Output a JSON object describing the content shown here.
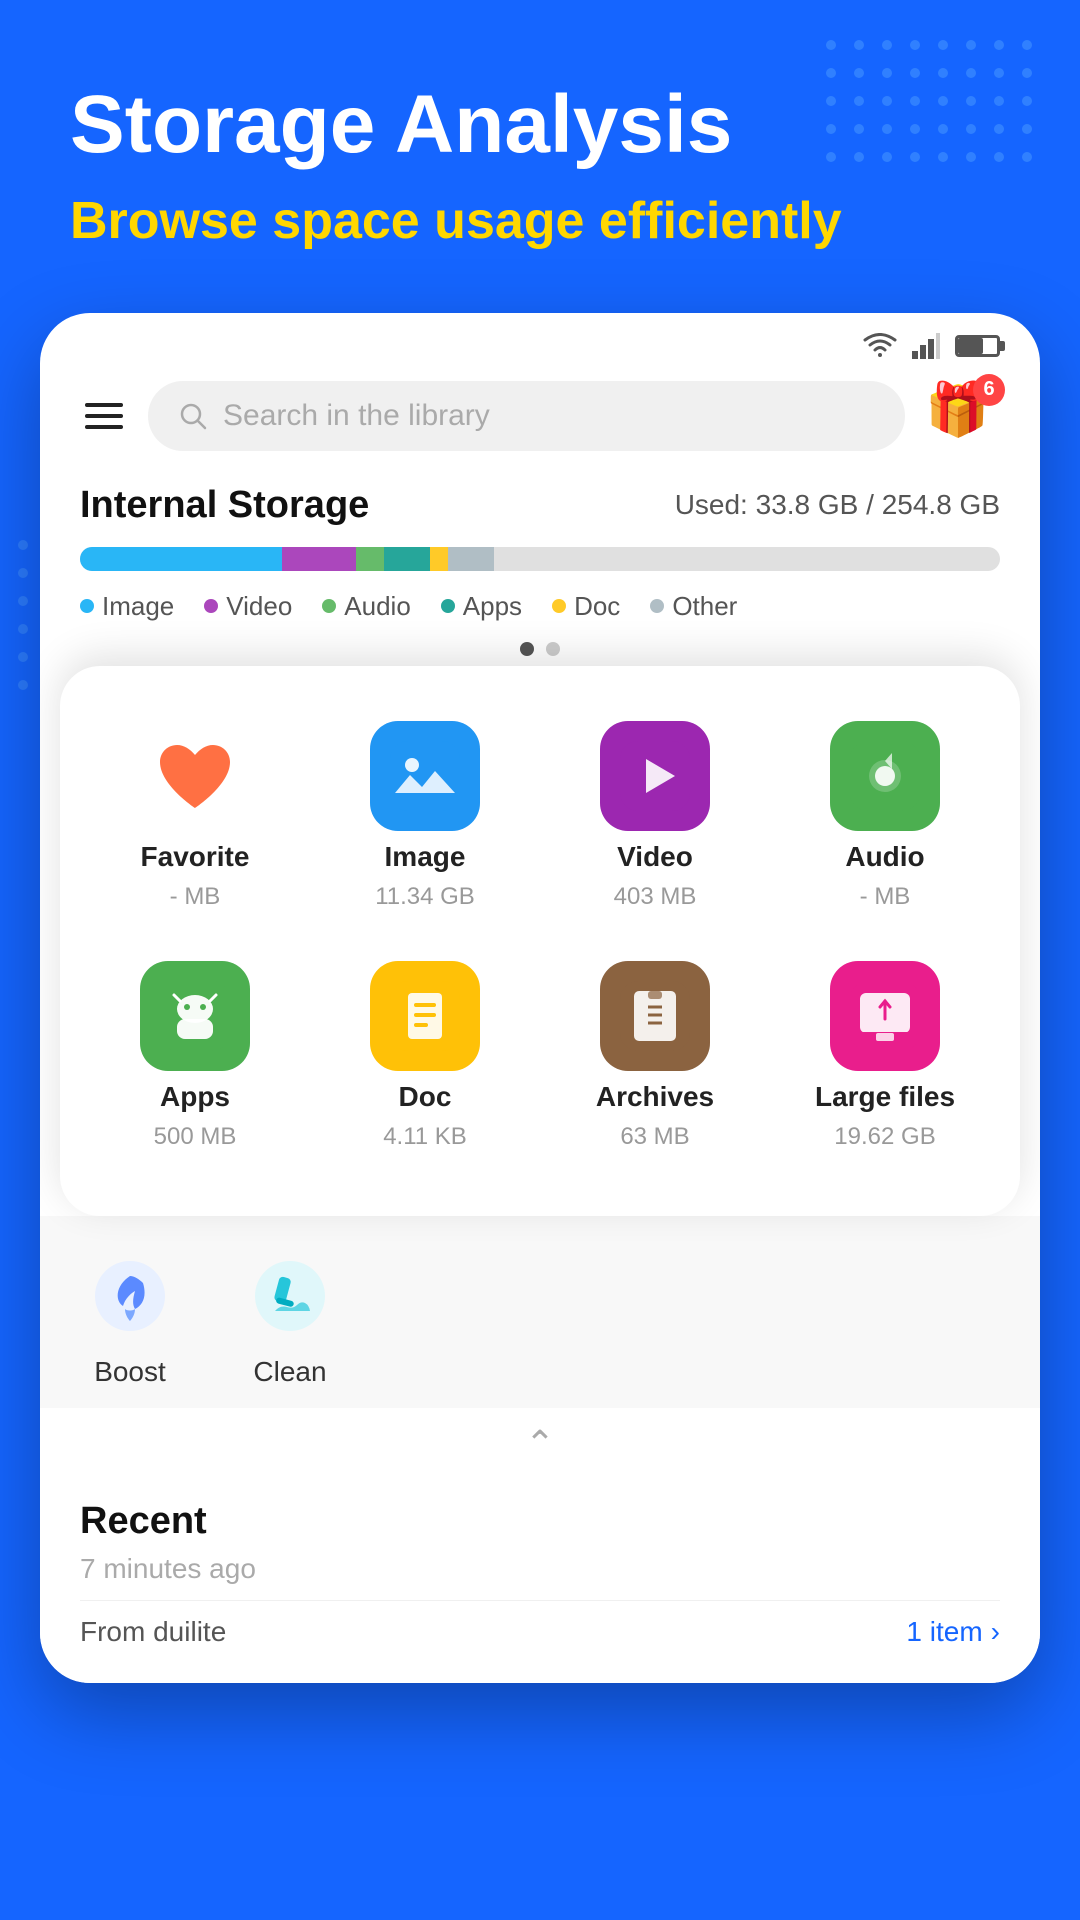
{
  "header": {
    "title": "Storage Analysis",
    "subtitle": "Browse space usage efficiently"
  },
  "statusBar": {
    "icons": [
      "wifi",
      "signal",
      "battery"
    ]
  },
  "appBar": {
    "search_placeholder": "Search in the library",
    "gift_badge": "6"
  },
  "storage": {
    "title": "Internal Storage",
    "used_label": "Used:",
    "used_value": "33.8 GB / 254.8 GB",
    "legend": [
      {
        "label": "Image",
        "color": "#29B6F6"
      },
      {
        "label": "Video",
        "color": "#AB47BC"
      },
      {
        "label": "Audio",
        "color": "#66BB6A"
      },
      {
        "label": "Apps",
        "color": "#26A69A"
      },
      {
        "label": "Doc",
        "color": "#FFCA28"
      },
      {
        "label": "Other",
        "color": "#B0BEC5"
      }
    ]
  },
  "fileGrid": [
    {
      "name": "Favorite",
      "size": "- MB",
      "icon": "heart",
      "color": "transparent"
    },
    {
      "name": "Image",
      "size": "11.34 GB",
      "icon": "image",
      "color": "#2196F3"
    },
    {
      "name": "Video",
      "size": "403 MB",
      "icon": "video",
      "color": "#9C27B0"
    },
    {
      "name": "Audio",
      "size": "- MB",
      "icon": "audio",
      "color": "#4CAF50"
    },
    {
      "name": "Apps",
      "size": "500 MB",
      "icon": "apps",
      "color": "#4CAF50"
    },
    {
      "name": "Doc",
      "size": "4.11 KB",
      "icon": "doc",
      "color": "#FFC107"
    },
    {
      "name": "Archives",
      "size": "63 MB",
      "icon": "archives",
      "color": "#8B6340"
    },
    {
      "name": "Large files",
      "size": "19.62 GB",
      "icon": "large",
      "color": "#E91E8C"
    }
  ],
  "tools": [
    {
      "name": "Boost",
      "icon": "🚀"
    },
    {
      "name": "Clean",
      "icon": "🧹"
    }
  ],
  "recent": {
    "title": "Recent",
    "time": "7 minutes ago",
    "source": "From duilite",
    "count_label": "1 item",
    "arrow": "›"
  }
}
